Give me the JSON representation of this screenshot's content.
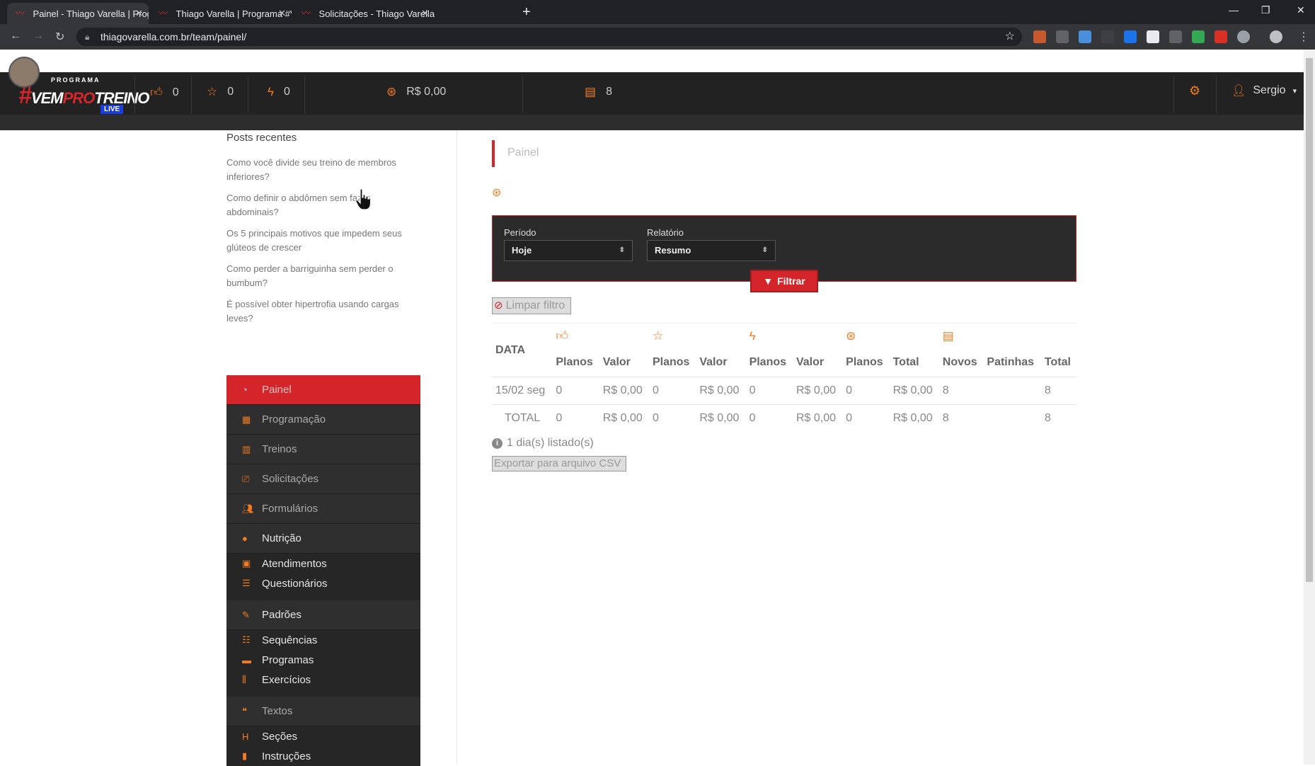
{
  "browser": {
    "tabs": [
      {
        "title": "Painel - Thiago Varella | Programa"
      },
      {
        "title": "Thiago Varella | Programa #VEMPRO"
      },
      {
        "title": "Solicitações - Thiago Varella | Pro"
      }
    ],
    "url": "thiagovarella.com.br/team/painel/"
  },
  "header": {
    "logo_small": "PROGRAMA",
    "logo_hash": "#",
    "logo_vem": "VEM",
    "logo_pro": "PRO",
    "logo_treino": "TREINO",
    "logo_badge": "LIVE",
    "stats": {
      "likes": "0",
      "stars": "0",
      "bolts": "0",
      "money": "R$ 0,00",
      "docs": "8"
    },
    "user_name": "Sergio"
  },
  "posts": {
    "title": "Posts recentes",
    "items": [
      "Como você divide seu treino de membros inferiores?",
      "Como definir o abdômen sem fazer abdominais?",
      "Os 5 principais motivos que impedem seus glúteos de crescer",
      "Como perder a barriguinha sem perder o bumbum?",
      "É possível obter hipertrofia usando cargas leves?"
    ]
  },
  "sidenav": {
    "painel": "Painel",
    "programacao": "Programação",
    "treinos": "Treinos",
    "solicitacoes": "Solicitações",
    "formularios": "Formulários",
    "nutricao": "Nutrição",
    "atendimentos": "Atendimentos",
    "questionarios": "Questionários",
    "padroes": "Padrões",
    "sequencias": "Sequências",
    "programas": "Programas",
    "exercicios": "Exercícios",
    "textos": "Textos",
    "secoes": "Seções",
    "instrucoes": "Instruções"
  },
  "main": {
    "title": "Painel",
    "filter": {
      "periodo_label": "Período",
      "periodo_value": "Hoje",
      "relatorio_label": "Relatório",
      "relatorio_value": "Resumo",
      "filtrar": "Filtrar",
      "limpar": "Limpar filtro"
    },
    "table": {
      "date_header": "DATA",
      "subheaders": [
        "Planos",
        "Valor",
        "Planos",
        "Valor",
        "Planos",
        "Valor",
        "Planos",
        "Total",
        "Novos",
        "Patinhas",
        "Total"
      ],
      "rows": [
        [
          "15/02 seg",
          "0",
          "R$ 0,00",
          "0",
          "R$ 0,00",
          "0",
          "R$ 0,00",
          "0",
          "R$ 0,00",
          "8",
          "",
          "8"
        ],
        [
          "TOTAL",
          "0",
          "R$ 0,00",
          "0",
          "R$ 0,00",
          "0",
          "R$ 0,00",
          "0",
          "R$ 0,00",
          "8",
          "",
          "8"
        ]
      ]
    },
    "count_text": "1 dia(s) listado(s)",
    "export_label": "Exportar para arquivo CSV"
  }
}
